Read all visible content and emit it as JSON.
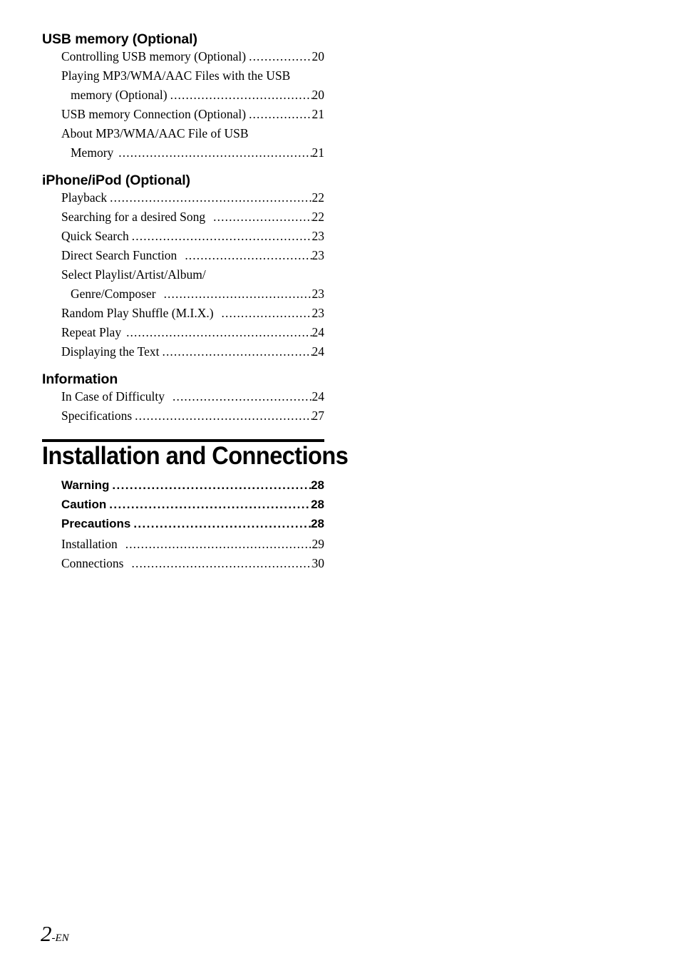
{
  "page": {
    "footer_number": "2",
    "footer_suffix": "-EN"
  },
  "sections": [
    {
      "heading": "USB memory (Optional)",
      "entries": [
        {
          "label": "Controlling USB memory (Optional)",
          "page": "20"
        },
        {
          "label": "Playing MP3/WMA/AAC Files with the USB",
          "cont": "memory (Optional)",
          "page": "20"
        },
        {
          "label": "USB memory Connection (Optional)",
          "page": "21"
        },
        {
          "label": "About MP3/WMA/AAC File of USB",
          "cont": "Memory",
          "page": "21"
        }
      ]
    },
    {
      "heading": "iPhone/iPod (Optional)",
      "entries": [
        {
          "label": "Playback",
          "page": "22"
        },
        {
          "label": "Searching for a desired Song",
          "page": "22"
        },
        {
          "label": "Quick Search",
          "page": "23"
        },
        {
          "label": "Direct Search Function",
          "page": "23"
        },
        {
          "label": "Select Playlist/Artist/Album/",
          "cont": "Genre/Composer",
          "page": "23"
        },
        {
          "label": "Random Play Shuffle (M.I.X.)",
          "page": "23"
        },
        {
          "label": "Repeat Play",
          "page": "24"
        },
        {
          "label": "Displaying the Text",
          "page": "24"
        }
      ]
    },
    {
      "heading": "Information",
      "entries": [
        {
          "label": "In Case of Difficulty",
          "page": "24"
        },
        {
          "label": "Specifications",
          "page": "27"
        }
      ]
    }
  ],
  "banner": {
    "title": "Installation and Connections",
    "bold_entries": [
      {
        "label": "Warning",
        "page": "28"
      },
      {
        "label": "Caution",
        "page": "28"
      },
      {
        "label": "Precautions",
        "page": "28"
      }
    ],
    "entries": [
      {
        "label": "Installation",
        "page": "29"
      },
      {
        "label": "Connections",
        "page": "30"
      }
    ]
  }
}
